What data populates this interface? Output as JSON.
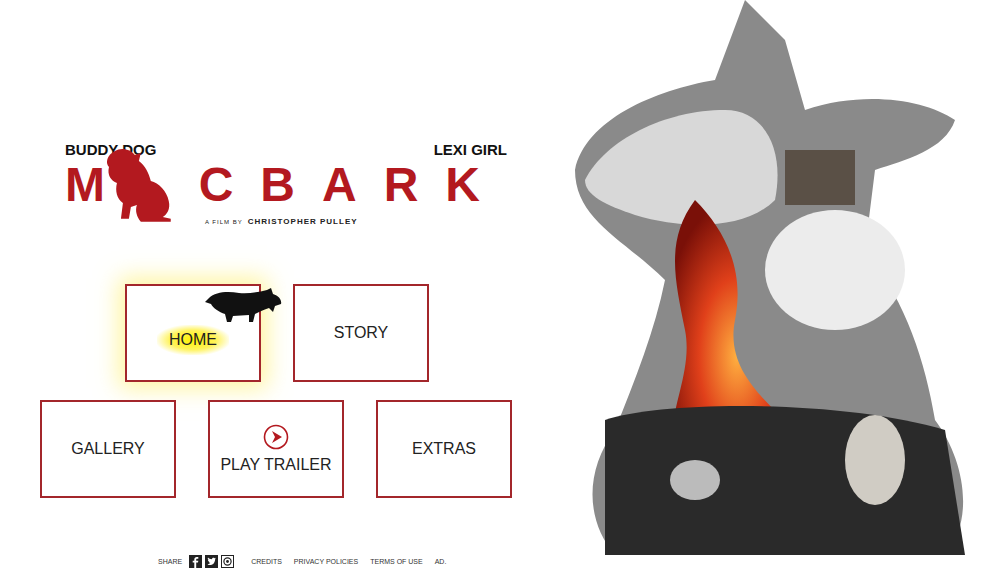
{
  "names": {
    "left": "BUDDY DOG",
    "right": "LEXI GIRL"
  },
  "title": {
    "left": "M",
    "right": "CBARK"
  },
  "byline": {
    "prefix": "A FILM BY",
    "name": "CHRISTOPHER PULLEY"
  },
  "menu": [
    {
      "label": "HOME",
      "selected": true,
      "kind": "plain"
    },
    {
      "label": "STORY",
      "selected": false,
      "kind": "plain"
    },
    {
      "label": "GALLERY",
      "selected": false,
      "kind": "plain"
    },
    {
      "label": "PLAY TRAILER",
      "selected": false,
      "kind": "play"
    },
    {
      "label": "EXTRAS",
      "selected": false,
      "kind": "plain"
    }
  ],
  "footer": {
    "share": "SHARE",
    "links": [
      "CREDITS",
      "PRIVACY POLICIES",
      "TERMS OF USE",
      "AD."
    ]
  }
}
